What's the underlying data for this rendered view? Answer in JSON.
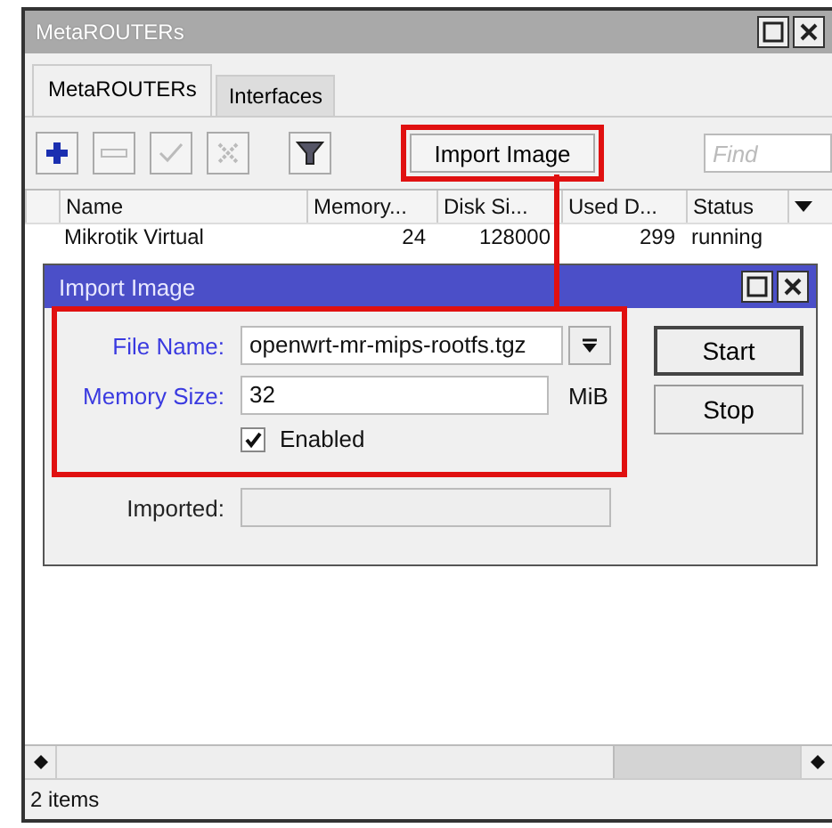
{
  "window": {
    "title": "MetaROUTERs"
  },
  "tabs": [
    {
      "label": "MetaROUTERs",
      "selected": true
    },
    {
      "label": "Interfaces",
      "selected": false
    }
  ],
  "toolbar": {
    "icon_buttons": [
      {
        "kind": "add",
        "disabled": false
      },
      {
        "kind": "remove",
        "disabled": true
      },
      {
        "kind": "enable",
        "disabled": true
      },
      {
        "kind": "disable",
        "disabled": true
      },
      {
        "kind": "filter",
        "disabled": false
      }
    ],
    "import_button": "Import Image",
    "search": {
      "placeholder": "Find"
    }
  },
  "table": {
    "columns": [
      "Name",
      "Memory...",
      "Disk Si...",
      "Used D...",
      "Status"
    ],
    "rows": [
      {
        "cells": [
          "Mikrotik Virtual",
          "24",
          "128000",
          "299",
          "running"
        ]
      }
    ]
  },
  "dialog": {
    "title": "Import Image",
    "fields": [
      {
        "kind": "dropdown",
        "label": "File Name:",
        "value": "openwrt-mr-mips-rootfs.tgz"
      },
      {
        "kind": "text",
        "label": "Memory Size:",
        "value": "32",
        "unit": "MiB"
      }
    ],
    "enabled": {
      "label": "Enabled",
      "checked": true
    },
    "imported": {
      "label": "Imported:"
    },
    "buttons": [
      "Start",
      "Stop"
    ]
  },
  "status_bar": "2 items"
}
